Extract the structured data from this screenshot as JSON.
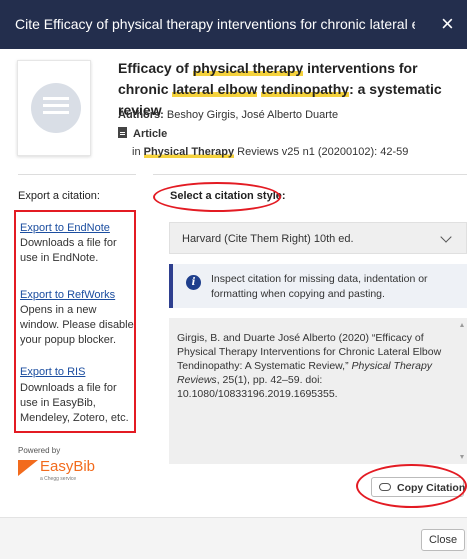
{
  "dialog": {
    "title": "Cite Efficacy of physical therapy interventions for chronic lateral elbow ...",
    "close_symbol": "×"
  },
  "record": {
    "title_parts": [
      "Efficacy of ",
      "physical therapy",
      " interventions for chronic ",
      "lateral elbow",
      " ",
      "tendinopathy",
      ": a systematic review"
    ],
    "authors_label": "Authors:",
    "authors": "Beshoy Girgis, José Alberto Duarte",
    "type": "Article",
    "source_prefix": "in ",
    "source_highlight": "Physical Therapy",
    "source_rest": " Reviews v25 n1 (20200102): 42-59",
    "thumbnail_icon": "document-icon"
  },
  "export": {
    "heading": "Export a citation:",
    "options": [
      {
        "link": "Export to EndNote",
        "desc": "Downloads a file for use in EndNote."
      },
      {
        "link": "Export to RefWorks",
        "desc": "Opens in a new window. Please disable your popup blocker."
      },
      {
        "link": "Export to RIS",
        "desc": "Downloads a file for use in EasyBib, Mendeley, Zotero, etc."
      }
    ]
  },
  "powered_by": {
    "label": "Powered by",
    "brand": "EasyBib",
    "tagline": "a Chegg service"
  },
  "citation": {
    "style_label": "Select a citation style:",
    "selected_style": "Harvard (Cite Them Right) 10th ed.",
    "info_text": "Inspect citation for missing data, indentation or formatting when copying and pasting.",
    "text_before": "Girgis, B. and Duarte José Alberto (2020) “Efficacy of Physical Therapy Interventions for Chronic Lateral Elbow Tendinopathy: A Systematic Review,” ",
    "journal": "Physical Therapy Reviews",
    "text_after": ", 25(1), pp. 42–59. doi: 10.1080/10833196.2019.1695355.",
    "copy_label": "Copy Citation"
  },
  "footer": {
    "close_label": "Close"
  },
  "colors": {
    "titlebar": "#232e4d",
    "highlight": "#f5d23c",
    "link": "#1c4ea0",
    "annotation": "#e31b23",
    "info_accent": "#2e3f8f",
    "easybib": "#f26b1d"
  }
}
